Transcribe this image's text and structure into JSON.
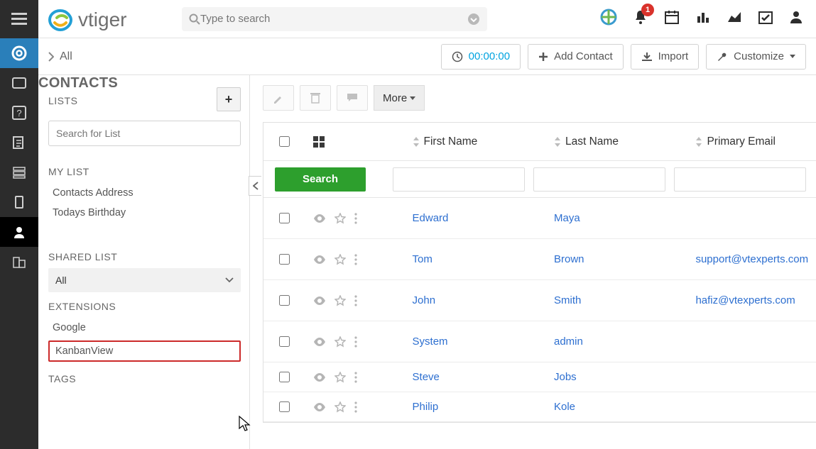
{
  "logo": "vtiger",
  "search": {
    "placeholder": "Type to search"
  },
  "notification_count": "1",
  "timer": "00:00:00",
  "breadcrumb": {
    "module": "CONTACTS",
    "sub": "All"
  },
  "buttons": {
    "add": "Add Contact",
    "import": "Import",
    "customize": "Customize"
  },
  "sidepanel": {
    "lists_title": "LISTS",
    "search_placeholder": "Search for List",
    "mylist_title": "MY LIST",
    "mylist": [
      {
        "label": "Contacts Address"
      },
      {
        "label": "Todays Birthday"
      }
    ],
    "shared_title": "SHARED LIST",
    "shared_all": "All",
    "ext_title": "EXTENSIONS",
    "ext": [
      {
        "label": "Google"
      },
      {
        "label": "KanbanView"
      }
    ],
    "tags_title": "TAGS"
  },
  "toolbar": {
    "more": "More"
  },
  "table": {
    "headers": {
      "fn": "First Name",
      "ln": "Last Name",
      "pe": "Primary Email"
    },
    "search_btn": "Search",
    "rows": [
      {
        "fn": "Edward",
        "ln": "Maya",
        "pe": ""
      },
      {
        "fn": "Tom",
        "ln": "Brown",
        "pe": "support@vtexperts.com"
      },
      {
        "fn": "John",
        "ln": "Smith",
        "pe": "hafiz@vtexperts.com"
      },
      {
        "fn": "System",
        "ln": "admin",
        "pe": ""
      },
      {
        "fn": "Steve",
        "ln": "Jobs",
        "pe": ""
      },
      {
        "fn": "Philip",
        "ln": "Kole",
        "pe": ""
      }
    ]
  }
}
